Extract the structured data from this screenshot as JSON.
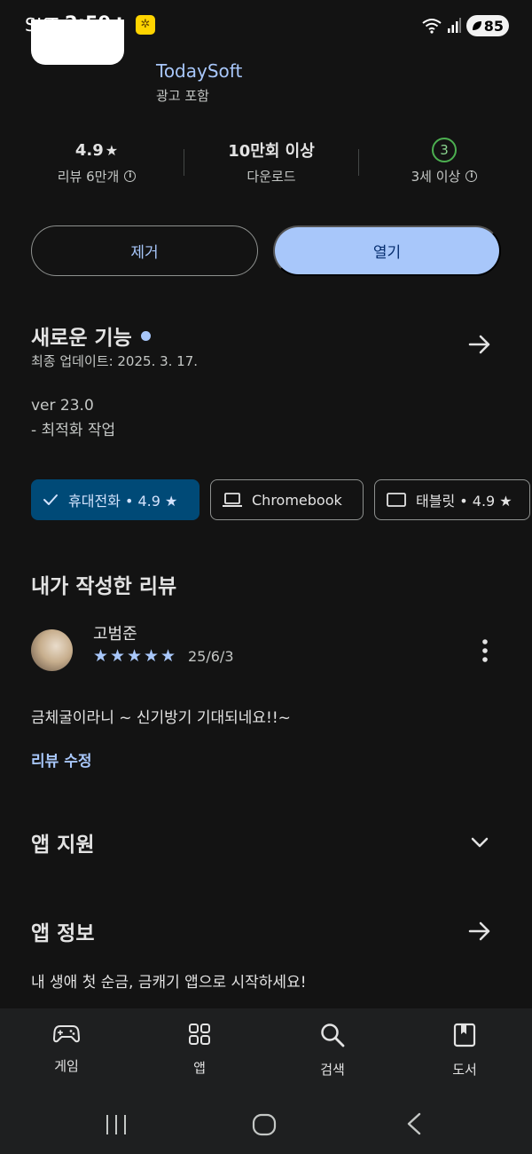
{
  "status_bar": {
    "carrier": "SKT",
    "time": "2:59",
    "notification_letter": "J",
    "battery": "85"
  },
  "app": {
    "developer": "TodaySoft",
    "ads_notice": "광고 포함"
  },
  "stats": {
    "rating": "4.9",
    "rating_label": "리뷰 6만개",
    "downloads": "10만회 이상",
    "downloads_label": "다운로드",
    "age_rating": "3",
    "age_label": "3세 이상"
  },
  "actions": {
    "remove_label": "제거",
    "open_label": "열기"
  },
  "whats_new": {
    "title": "새로운 기능",
    "last_updated": "최종 업데이트: 2025. 3. 17.",
    "notes": [
      "ver 23.0",
      "- 최적화 작업"
    ]
  },
  "device_chips": [
    {
      "label": "휴대전화 • 4.9 ★",
      "selected": true,
      "icon": "check-icon"
    },
    {
      "label": "Chromebook",
      "selected": false,
      "icon": "laptop-icon"
    },
    {
      "label": "태블릿 • 4.9 ★",
      "selected": false,
      "icon": "tablet-icon"
    }
  ],
  "my_review": {
    "title": "내가 작성한 리뷰",
    "reviewer": "고범준",
    "stars": 5,
    "date": "25/6/3",
    "text": "금체굴이라니 ~ 신기방기 기대되네요!!~",
    "edit_label": "리뷰 수정"
  },
  "app_support": {
    "title": "앱 지원"
  },
  "app_info": {
    "title": "앱 정보",
    "description": "내 생애 첫 순금, 금캐기 앱으로 시작하세요!"
  },
  "bottom_nav": [
    {
      "label": "게임",
      "icon": "gamepad-icon"
    },
    {
      "label": "앱",
      "icon": "apps-grid-icon"
    },
    {
      "label": "검색",
      "icon": "search-icon"
    },
    {
      "label": "도서",
      "icon": "book-icon"
    }
  ],
  "colors": {
    "background": "#131313",
    "accent": "#a8c7fa",
    "selected_chip": "#004a77",
    "nav_bg": "#1e1f20"
  }
}
